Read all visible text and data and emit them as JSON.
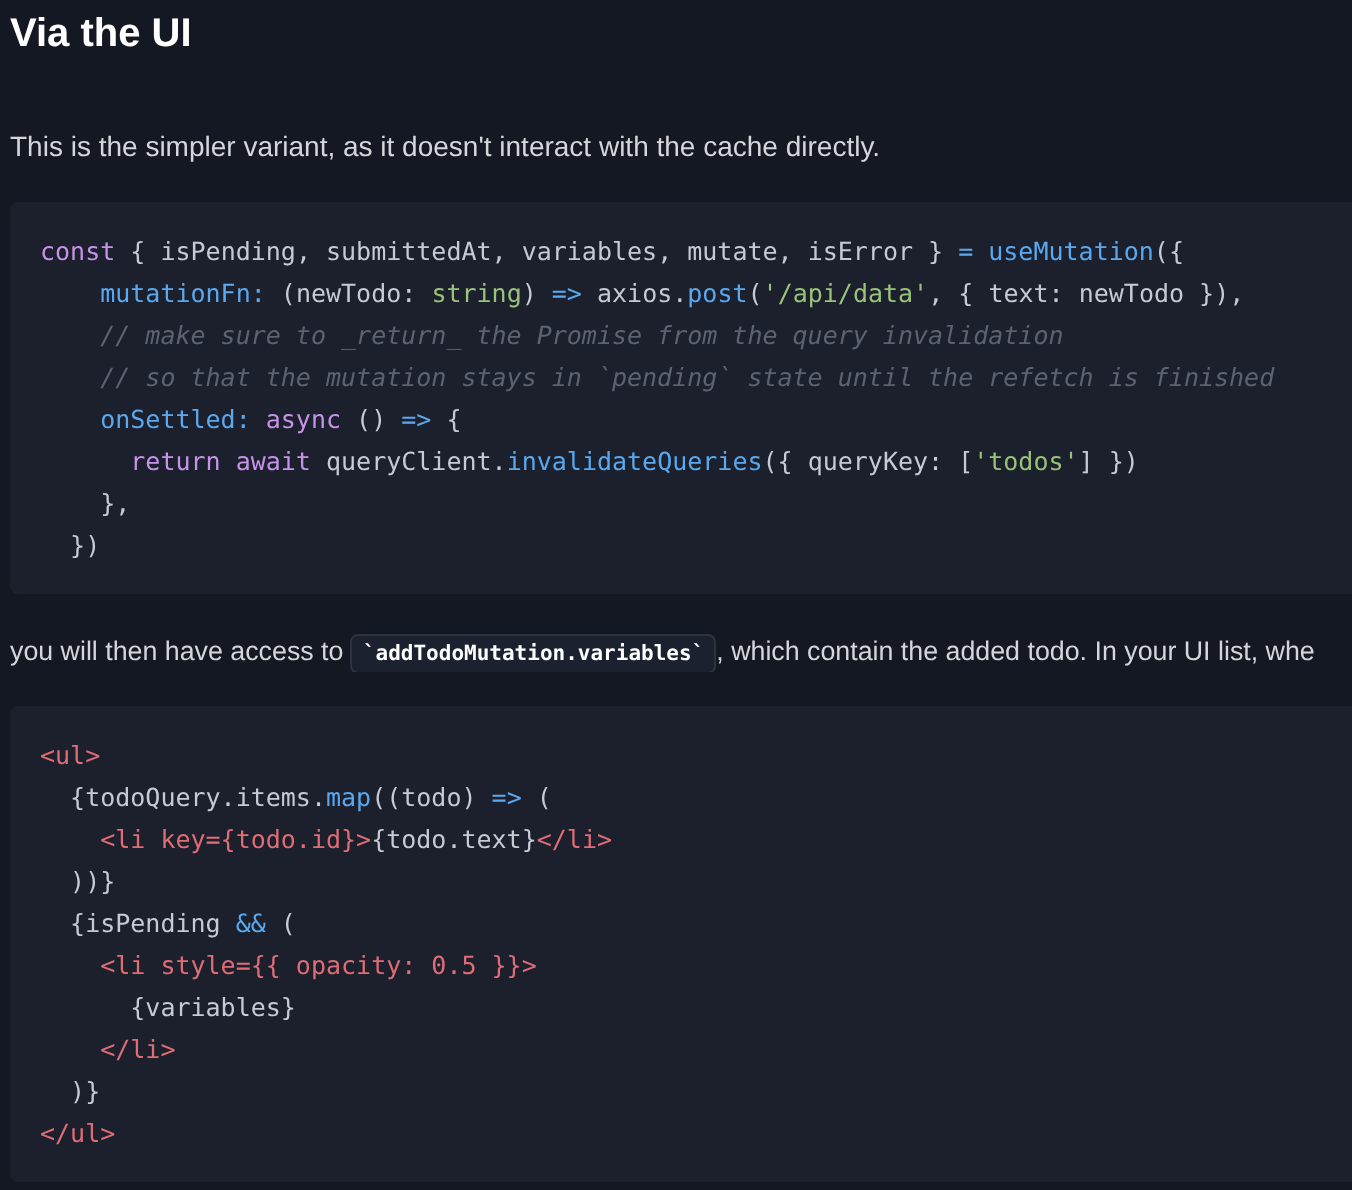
{
  "heading": "Via the UI",
  "intro": "This is the simpler variant, as it doesn't interact with the cache directly.",
  "code_block_1": [
    [
      {
        "kind": "keyword",
        "text": "const"
      },
      {
        "kind": "plain",
        "text": " { isPending, submittedAt, variables, mutate, isError } "
      },
      {
        "kind": "operator",
        "text": "="
      },
      {
        "kind": "function",
        "text": " useMutation"
      },
      {
        "kind": "plain",
        "text": "({"
      }
    ],
    [
      {
        "kind": "function",
        "text": "    mutationFn:"
      },
      {
        "kind": "plain",
        "text": " (newTodo: "
      },
      {
        "kind": "type",
        "text": "string"
      },
      {
        "kind": "plain",
        "text": ") "
      },
      {
        "kind": "operator",
        "text": "=>"
      },
      {
        "kind": "plain",
        "text": " axios."
      },
      {
        "kind": "function",
        "text": "post"
      },
      {
        "kind": "plain",
        "text": "("
      },
      {
        "kind": "string",
        "text": "'/api/data'"
      },
      {
        "kind": "plain",
        "text": ", { text: newTodo }),"
      }
    ],
    [
      {
        "kind": "comment",
        "text": "    // make sure to _return_ the Promise from the query invalidation"
      }
    ],
    [
      {
        "kind": "comment",
        "text": "    // so that the mutation stays in `pending` state until the refetch is finished"
      }
    ],
    [
      {
        "kind": "function",
        "text": "    onSettled:"
      },
      {
        "kind": "keyword",
        "text": " async"
      },
      {
        "kind": "plain",
        "text": " () "
      },
      {
        "kind": "operator",
        "text": "=>"
      },
      {
        "kind": "plain",
        "text": " {"
      }
    ],
    [
      {
        "kind": "keyword",
        "text": "      return await"
      },
      {
        "kind": "plain",
        "text": " queryClient."
      },
      {
        "kind": "function",
        "text": "invalidateQueries"
      },
      {
        "kind": "plain",
        "text": "({ queryKey: ["
      },
      {
        "kind": "string",
        "text": "'todos'"
      },
      {
        "kind": "plain",
        "text": "] })"
      }
    ],
    [
      {
        "kind": "plain",
        "text": "    },"
      }
    ],
    [
      {
        "kind": "plain",
        "text": "  })"
      }
    ]
  ],
  "paragraph_2": {
    "before": "you will then have access to ",
    "code": "`addTodoMutation.variables`",
    "after": ", which contain the added todo. In your UI list, whe"
  },
  "code_block_2": [
    [
      {
        "kind": "tag",
        "text": "<ul>"
      }
    ],
    [
      {
        "kind": "plain",
        "text": "  {todoQuery.items."
      },
      {
        "kind": "function",
        "text": "map"
      },
      {
        "kind": "plain",
        "text": "((todo) "
      },
      {
        "kind": "operator",
        "text": "=>"
      },
      {
        "kind": "plain",
        "text": " ("
      }
    ],
    [
      {
        "kind": "tag",
        "text": "    <li key={todo.id}>"
      },
      {
        "kind": "plain",
        "text": "{todo.text}"
      },
      {
        "kind": "tag",
        "text": "</li>"
      }
    ],
    [
      {
        "kind": "plain",
        "text": "  ))}"
      }
    ],
    [
      {
        "kind": "plain",
        "text": "  {isPending "
      },
      {
        "kind": "operator",
        "text": "&&"
      },
      {
        "kind": "plain",
        "text": " ("
      }
    ],
    [
      {
        "kind": "tag",
        "text": "    <li style={{ opacity: 0.5 }}>"
      }
    ],
    [
      {
        "kind": "plain",
        "text": "      {variables}"
      }
    ],
    [
      {
        "kind": "tag",
        "text": "    </li>"
      }
    ],
    [
      {
        "kind": "plain",
        "text": "  )}"
      }
    ],
    [
      {
        "kind": "tag",
        "text": "</ul>"
      }
    ]
  ]
}
